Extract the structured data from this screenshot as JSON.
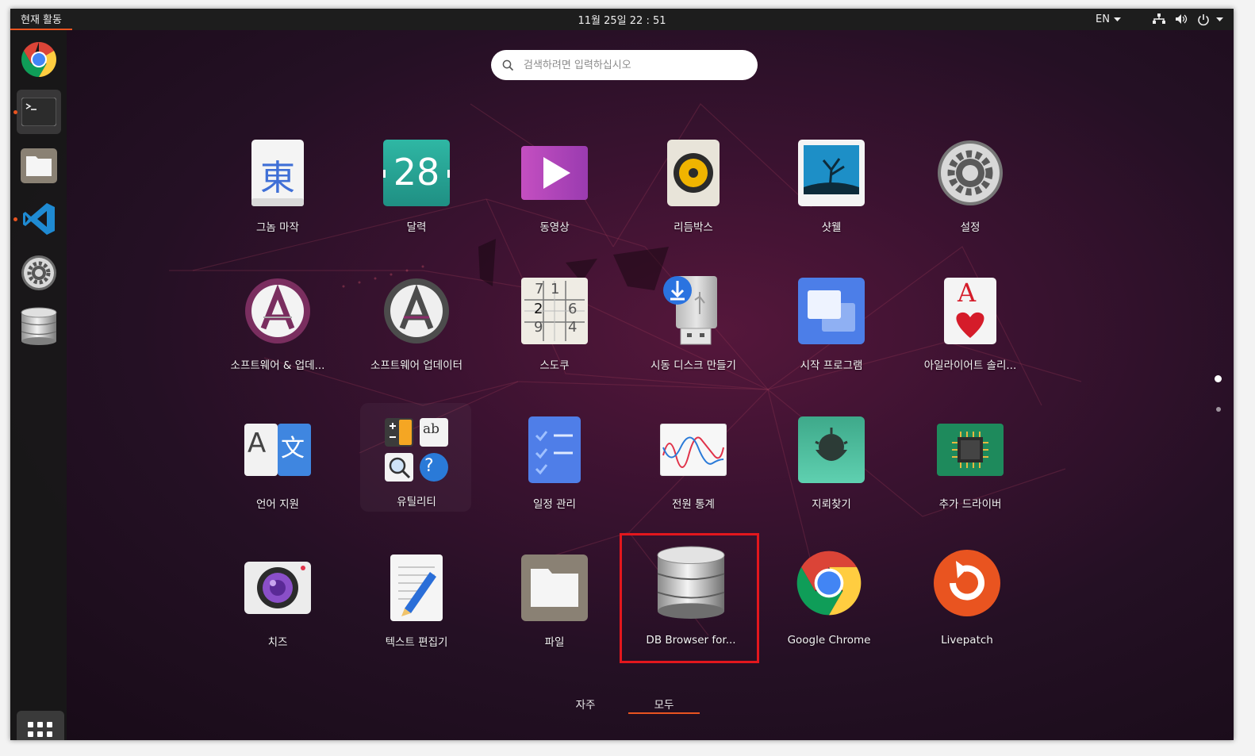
{
  "topbar": {
    "activities": "현재 활동",
    "clock": "11월 25일  22 : 51",
    "language": "EN"
  },
  "dock": {
    "items": [
      "chrome",
      "terminal",
      "files",
      "vscode",
      "settings",
      "db-browser"
    ]
  },
  "search": {
    "placeholder": "검색하려면 입력하십시오"
  },
  "apps": [
    {
      "label": "그놈 마작"
    },
    {
      "label": "달력",
      "icon_text": "28"
    },
    {
      "label": "동영상"
    },
    {
      "label": "리듬박스"
    },
    {
      "label": "샷웰"
    },
    {
      "label": "설정"
    },
    {
      "label": "소프트웨어 & 업데..."
    },
    {
      "label": "소프트웨어 업데이터"
    },
    {
      "label": "스도쿠"
    },
    {
      "label": "시동 디스크 만들기"
    },
    {
      "label": "시작 프로그램"
    },
    {
      "label": "아일라이어트 솔리..."
    },
    {
      "label": "언어 지원"
    },
    {
      "label": "유틸리티"
    },
    {
      "label": "일정 관리"
    },
    {
      "label": "전원 통계"
    },
    {
      "label": "지뢰찾기"
    },
    {
      "label": "추가 드라이버"
    },
    {
      "label": "치즈"
    },
    {
      "label": "텍스트 편집기"
    },
    {
      "label": "파일"
    },
    {
      "label": "DB Browser for..."
    },
    {
      "label": "Google Chrome"
    },
    {
      "label": "Livepatch"
    }
  ],
  "icon_glyphs": {
    "mahjong": "東",
    "lang_a": "A",
    "lang_b": "文",
    "solitaire": "A"
  },
  "sudoku_digits": [
    "7",
    "1",
    "2",
    "6",
    "9",
    "4"
  ],
  "tabs": {
    "frequent": "자주",
    "all": "모두",
    "selected": "all"
  },
  "pages": {
    "current": 1,
    "total": 2
  },
  "colors": {
    "accent": "#e95420",
    "highlight": "#e3171d",
    "topbar": "#1d1d1d"
  }
}
